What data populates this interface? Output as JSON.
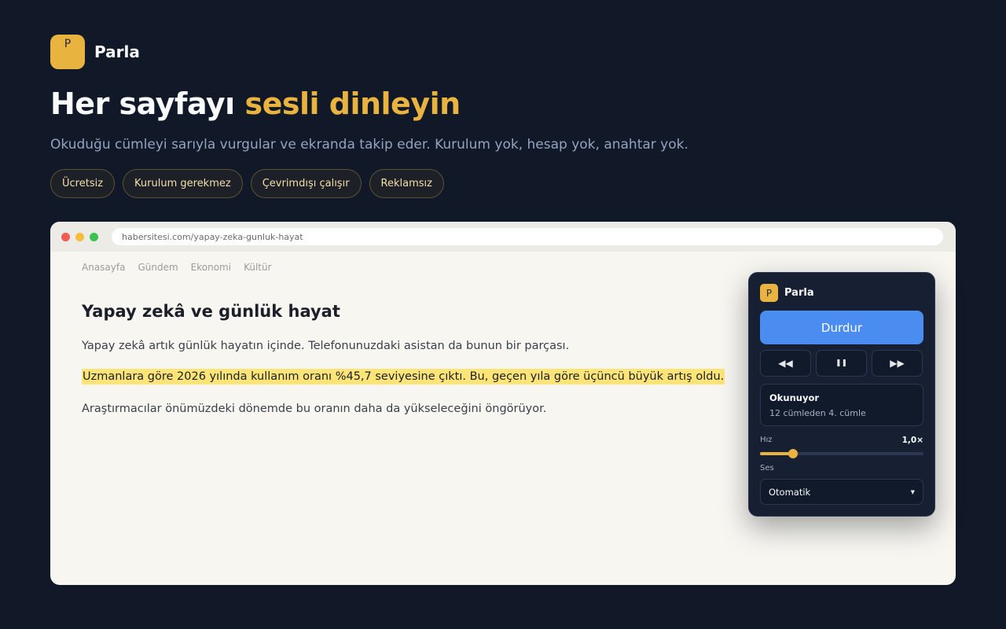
{
  "brand": {
    "logo_letter": "P",
    "name": "Parla",
    "accent_color": "#e9b33f"
  },
  "hero": {
    "title_main": "Her sayfayı ",
    "title_accent": "sesli dinleyin",
    "subtitle": "Okuduğu cümleyi sarıyla vurgular ve ekranda takip eder. Kurulum yok, hesap yok, anahtar yok."
  },
  "chips": [
    "Ücretsiz",
    "Kurulum gerekmez",
    "Çevrimdışı çalışır",
    "Reklamsız"
  ],
  "browser": {
    "url": "habersitesi.com/yapay-zeka-gunluk-hayat"
  },
  "site": {
    "nav": [
      "Anasayfa",
      "Gündem",
      "Ekonomi",
      "Kültür"
    ],
    "article_title": "Yapay zekâ ve günlük hayat",
    "paragraphs": [
      "Yapay zekâ artık günlük hayatın içinde. Telefonunuzdaki asistan da bunun bir parçası.",
      "Uzmanlara göre 2026 yılında kullanım oranı %45,7 seviyesine çıktı. Bu, geçen yıla göre üçüncü büyük artış oldu.",
      "Araştırmacılar önümüzdeki dönemde bu oranın daha da yükseleceğini öngörüyor."
    ],
    "highlight_color": "#fde477"
  },
  "panel": {
    "logo_letter": "P",
    "name": "Parla",
    "stop_label": "Durdur",
    "controls": {
      "rewind_icon": "◀◀",
      "pause_icon": "❚❚",
      "forward_icon": "▶▶"
    },
    "status_title": "Okunuyor",
    "status_sub": "12 cümleden 4. cümle",
    "speed_label": "Hız",
    "speed_value": "1,0×",
    "speed_fraction": 0.2,
    "voice_label": "Ses",
    "voice_value": "Otomatik",
    "primary_color": "#4a8cf0"
  }
}
